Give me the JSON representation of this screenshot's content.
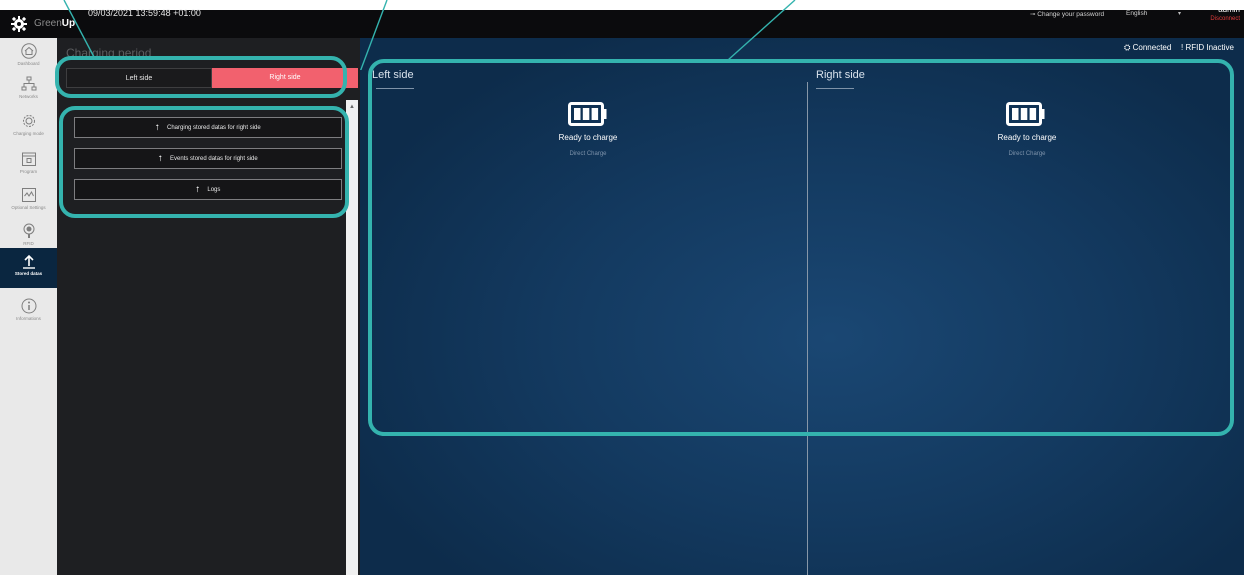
{
  "topbar": {
    "brand_part1": "Green",
    "brand_part2": "Up",
    "datetime": "09/03/2021 13:59:48 +01:00",
    "change_password": "Change your password",
    "language": "English",
    "user": "admin",
    "disconnect": "Disconnect"
  },
  "nav": {
    "items": [
      {
        "label": "Dashboard",
        "icon": "home-icon"
      },
      {
        "label": "Networks",
        "icon": "network-icon"
      },
      {
        "label": "Charging mode",
        "icon": "gear-icon"
      },
      {
        "label": "Program",
        "icon": "calendar-icon"
      },
      {
        "label": "Optional Settings",
        "icon": "settings-panel-icon"
      },
      {
        "label": "RFID",
        "icon": "rfid-icon"
      },
      {
        "label": "Stored datas",
        "icon": "upload-icon"
      },
      {
        "label": "Informations",
        "icon": "info-icon"
      }
    ],
    "active_index": 6
  },
  "stored_datas": {
    "title": "Charging period",
    "segment_left": "Left side",
    "segment_right": "Right side",
    "selected_segment": "Right side",
    "buttons": [
      "Charging stored datas for right side",
      "Events stored datas for right side",
      "Logs"
    ]
  },
  "status": {
    "connection": "Connected",
    "rfid": "RFID Inactive"
  },
  "sides": {
    "left": {
      "title": "Left side",
      "state": "Ready to charge",
      "mode": "Direct Charge"
    },
    "right": {
      "title": "Right side",
      "state": "Ready to charge",
      "mode": "Direct Charge"
    }
  },
  "colors": {
    "accent": "#f2616e",
    "callout": "#34b3ae",
    "main_bg": "#13395f",
    "nav_active": "#0a2640"
  }
}
